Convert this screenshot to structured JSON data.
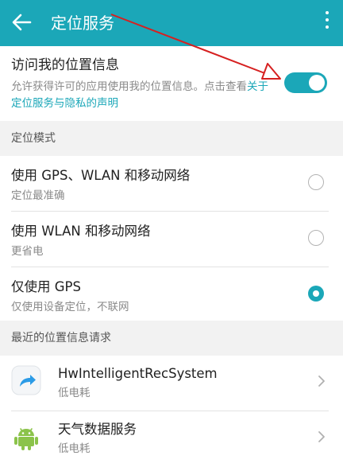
{
  "colors": {
    "accent": "#1ba7b8",
    "annotation_arrow": "#d62020"
  },
  "appbar": {
    "title": "定位服务",
    "back_icon": "arrow-left",
    "menu_icon": "more-vertical"
  },
  "location_access": {
    "title": "访问我的位置信息",
    "description": "允许获得许可的应用使用我的位置信息。点击查看",
    "link": "关于定位服务与隐私的声明",
    "enabled": true
  },
  "mode_section": {
    "header": "定位模式",
    "options": [
      {
        "title": "使用 GPS、WLAN 和移动网络",
        "subtitle": "定位最准确",
        "selected": false
      },
      {
        "title": "使用 WLAN 和移动网络",
        "subtitle": "更省电",
        "selected": false
      },
      {
        "title": "仅使用 GPS",
        "subtitle": "仅使用设备定位，不联网",
        "selected": true
      }
    ]
  },
  "recent_section": {
    "header": "最近的位置信息请求",
    "apps": [
      {
        "name": "HwIntelligentRecSystem",
        "subtitle": "低电耗",
        "icon": "share-arrow-icon"
      },
      {
        "name": "天气数据服务",
        "subtitle": "低电耗",
        "icon": "android-icon"
      }
    ]
  }
}
